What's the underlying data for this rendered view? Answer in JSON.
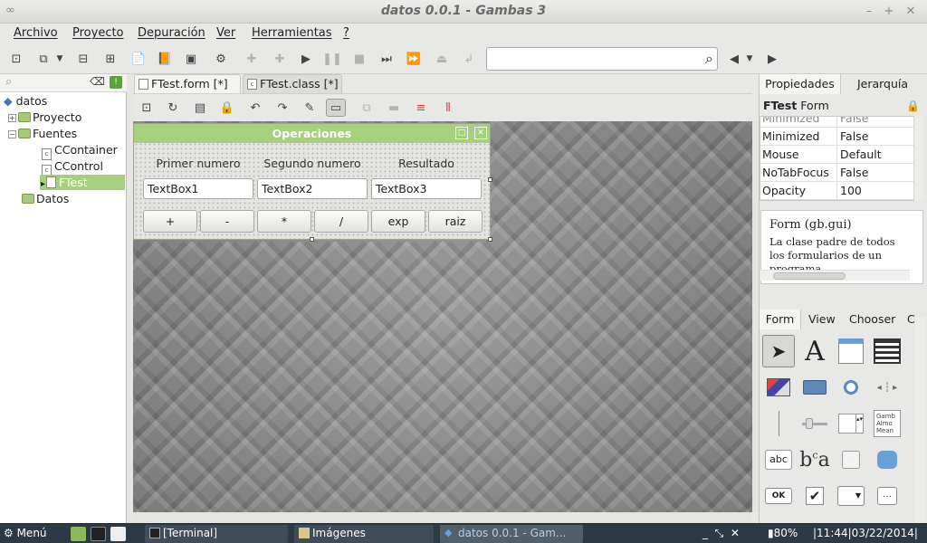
{
  "window": {
    "title": "datos 0.0.1 - Gambas 3"
  },
  "menu": [
    "Archivo",
    "Proyecto",
    "Depuración",
    "Ver",
    "Herramientas",
    "?"
  ],
  "search": {
    "value": ""
  },
  "tree": {
    "root": "datos",
    "proyecto": "Proyecto",
    "fuentes": "Fuentes",
    "ccontainer": "CContainer",
    "ccontrol": "CControl",
    "ftest": "FTest",
    "datos_folder": "Datos",
    "class_glyph": "c"
  },
  "tabs": [
    {
      "label": "FTest.form [*]"
    },
    {
      "label": "FTest.class [*]"
    }
  ],
  "form": {
    "title": "Operaciones",
    "labels": [
      "Primer numero",
      "Segundo numero",
      "Resultado"
    ],
    "textboxes": [
      "TextBox1",
      "TextBox2",
      "TextBox3"
    ],
    "buttons": [
      "+",
      "-",
      "*",
      "/",
      "exp",
      "raiz"
    ]
  },
  "right": {
    "tabs": [
      "Propiedades",
      "Jerarquía"
    ],
    "selected_name": "FTest",
    "selected_type": "Form",
    "properties": [
      {
        "name": "Minimized",
        "value": "False"
      },
      {
        "name": "Mouse",
        "value": "Default"
      },
      {
        "name": "NoTabFocus",
        "value": "False"
      },
      {
        "name": "Opacity",
        "value": "100"
      }
    ],
    "help_title": "Form (gb.gui)",
    "help_desc": "La clase padre de todos los formularios de un programa."
  },
  "toolbox": {
    "tabs": [
      "Form",
      "View",
      "Chooser",
      "C"
    ],
    "sample_text": "abc",
    "ok_label": "OK",
    "list_sample": "Gamb Almo Mean"
  },
  "taskbar": {
    "menu_label": "Menú",
    "tasks": [
      "[Terminal]",
      "Imágenes",
      "datos 0.0.1 - Gam..."
    ],
    "battery": "80%",
    "datetime": "11:44|03/22/2014|"
  },
  "colors": {
    "form_title": "#a6cf7e",
    "taskbar": "#2c3a45",
    "tree_selected": "#a6cf7e"
  }
}
